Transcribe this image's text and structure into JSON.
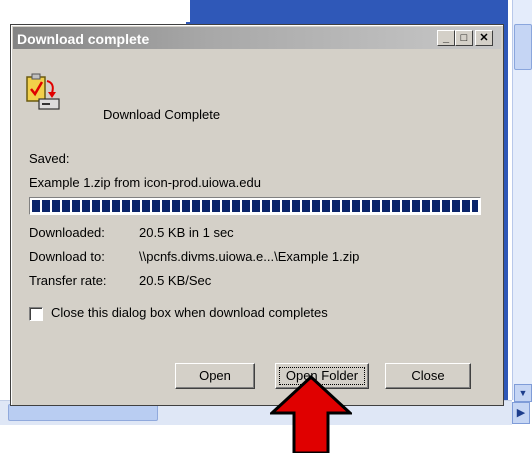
{
  "dialog": {
    "title": "Download complete",
    "heading": "Download Complete",
    "saved_label": "Saved:",
    "saved_value": "Example 1.zip from icon-prod.uiowa.edu",
    "progress_percent": 100,
    "rows": [
      {
        "label": "Downloaded:",
        "value": "20.5 KB in 1 sec"
      },
      {
        "label": "Download to:",
        "value": "\\\\pcnfs.divms.uiowa.e...\\Example 1.zip"
      },
      {
        "label": "Transfer rate:",
        "value": "20.5 KB/Sec"
      }
    ],
    "checkbox_label": "Close this dialog box when download completes",
    "checkbox_checked": false,
    "buttons": {
      "open": "Open",
      "open_folder": "Open Folder",
      "close": "Close"
    },
    "titlebar_buttons": {
      "minimize": "_",
      "maximize": "□",
      "close": "✕"
    }
  },
  "colors": {
    "dialog_bg": "#d4d0c8",
    "progress": "#0a246a",
    "arrow": "#e00000",
    "background_panel": "#2f58b8"
  },
  "icons": [
    "download-complete-icon",
    "red-up-arrow"
  ]
}
